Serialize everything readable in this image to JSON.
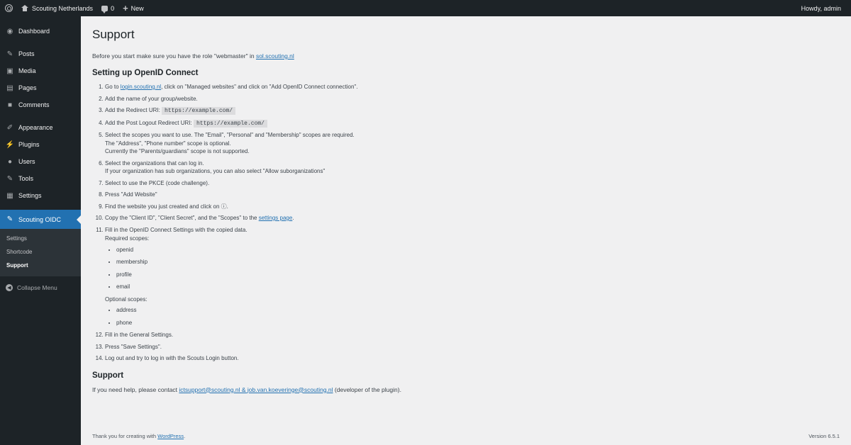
{
  "adminbar": {
    "site_name": "Scouting Netherlands",
    "comments_count": "0",
    "new_label": "New",
    "howdy": "Howdy, admin"
  },
  "sidebar": {
    "items": [
      {
        "label": "Dashboard",
        "icon": "dashboard-icon"
      },
      {
        "label": "Posts",
        "icon": "pin-icon"
      },
      {
        "label": "Media",
        "icon": "media-icon"
      },
      {
        "label": "Pages",
        "icon": "pages-icon"
      },
      {
        "label": "Comments",
        "icon": "comment-icon"
      },
      {
        "label": "Appearance",
        "icon": "brush-icon"
      },
      {
        "label": "Plugins",
        "icon": "plugin-icon"
      },
      {
        "label": "Users",
        "icon": "user-icon"
      },
      {
        "label": "Tools",
        "icon": "wrench-icon"
      },
      {
        "label": "Settings",
        "icon": "settings-icon"
      }
    ],
    "current": {
      "label": "Scouting OIDC",
      "icon": "wrench-icon"
    },
    "submenu": [
      "Settings",
      "Shortcode",
      "Support"
    ],
    "collapse_label": "Collapse Menu"
  },
  "page": {
    "title": "Support",
    "intro_before": "Before you start make sure you have the role \"webmaster\" in ",
    "intro_link": "sol.scouting.nl",
    "setup_heading": "Setting up OpenID Connect",
    "steps": {
      "s1_a": "Go to ",
      "s1_link": "login.scouting.nl",
      "s1_b": ", click on \"Managed websites\" and click on \"Add OpenID Connect connection\".",
      "s2": "Add the name of your group/website.",
      "s3": "Add the Redirect URI: ",
      "s3_code": "https://example.com/",
      "s4": "Add the Post Logout Redirect URI: ",
      "s4_code": "https://example.com/",
      "s5_l1": "Select the scopes you want to use. The \"Email\", \"Personal\" and \"Membership\" scopes are required.",
      "s5_l2": "The \"Address\", \"Phone number\" scope is optional.",
      "s5_l3": "Currently the \"Parents/guardians\" scope is not supported.",
      "s6_l1": "Select the organizations that can log in.",
      "s6_l2": "If your organization has sub organizations, you can also select \"Allow suborganizations\"",
      "s7": "Select to use the PKCE (code challenge).",
      "s8": "Press \"Add Website\"",
      "s9": "Find the website you just created and click on ",
      "s9_icon": "ⓘ",
      "s9_end": ".",
      "s10_a": "Copy the \"Client ID\", \"Client Secret\", and the \"Scopes\" to the ",
      "s10_link": "settings page",
      "s10_b": ".",
      "s11": "Fill in the OpenID Connect Settings with the copied data.",
      "required_label": "Required scopes:",
      "required_scopes": [
        "openid",
        "membership",
        "profile",
        "email"
      ],
      "optional_label": "Optional scopes:",
      "optional_scopes": [
        "address",
        "phone"
      ],
      "s12": "Fill in the General Settings.",
      "s13": "Press \"Save Settings\".",
      "s14": "Log out and try to log in with the Scouts Login button."
    },
    "support_heading": "Support",
    "support_before": "If you need help, please contact ",
    "support_link": "ictsupport@scouting.nl & job.van.koeveringe@scouting.nl",
    "support_after": " (developer of the plugin)."
  },
  "footer": {
    "thanks_before": "Thank you for creating with ",
    "thanks_link": "WordPress",
    "thanks_after": ".",
    "version": "Version 6.5.1"
  }
}
